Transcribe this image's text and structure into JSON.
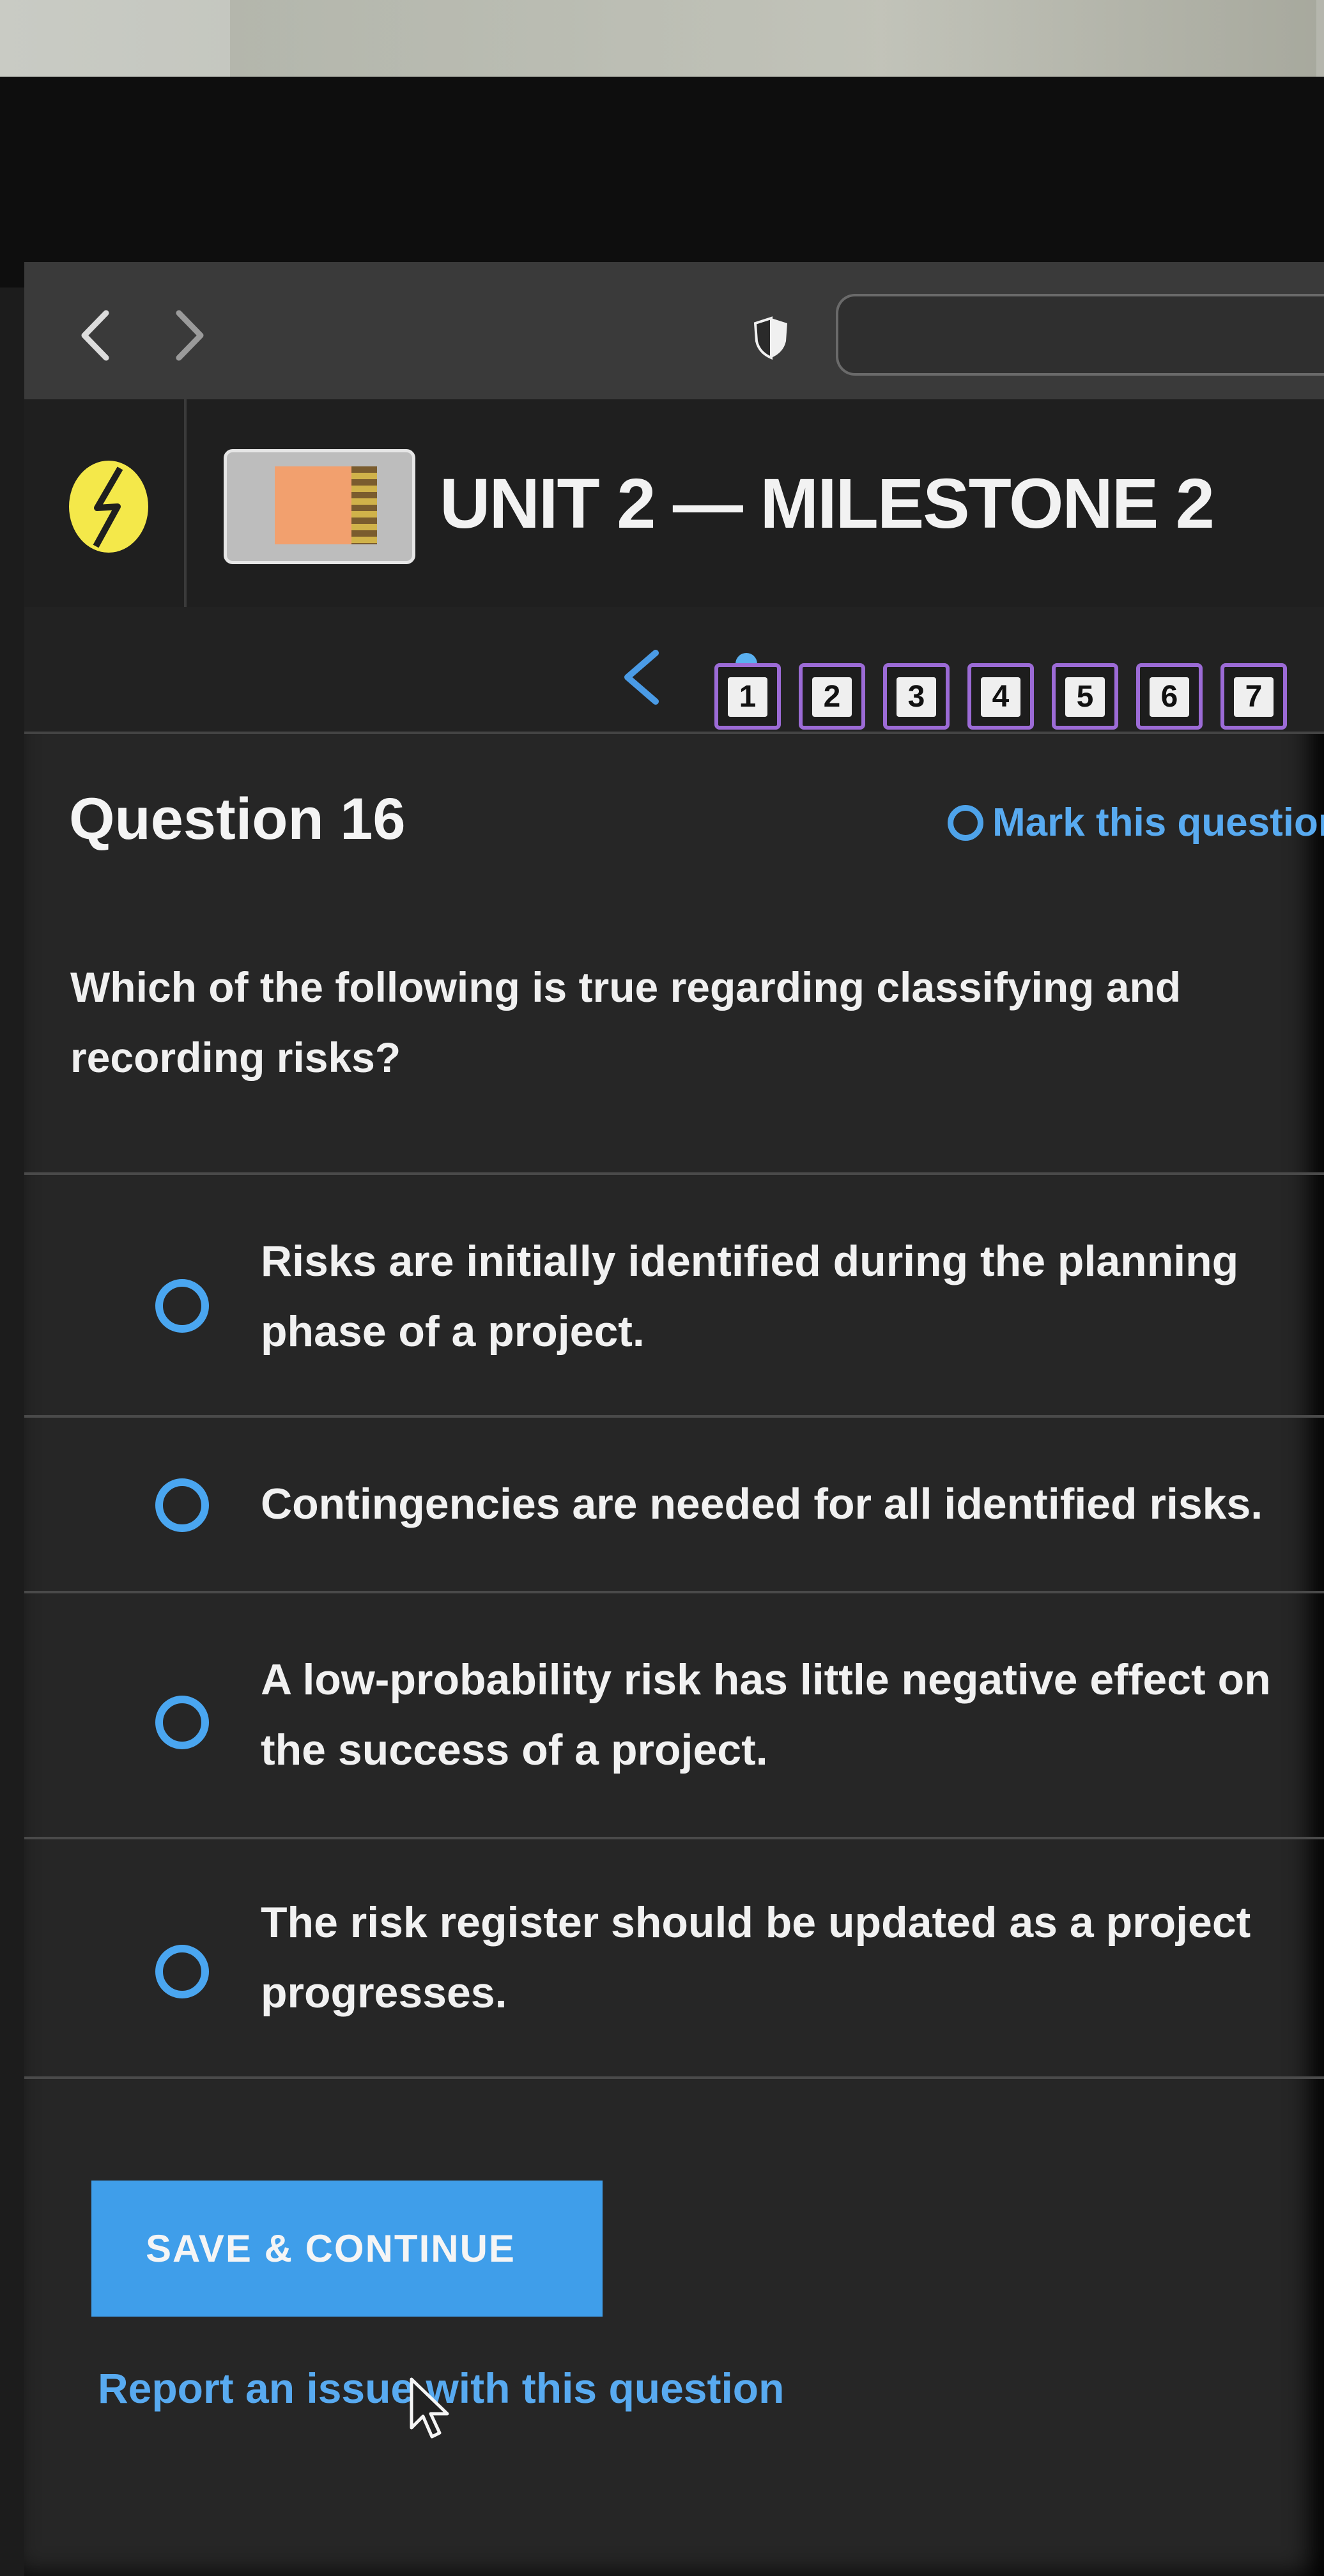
{
  "browser": {
    "back_icon": "chevron-left-icon",
    "forward_icon": "chevron-right-icon",
    "shield_icon": "shield-icon"
  },
  "header": {
    "title": "UNIT 2 — MILESTONE 2"
  },
  "nav": {
    "prev_icon": "chevron-left-icon",
    "numbers": [
      "1",
      "2",
      "3",
      "4",
      "5",
      "6",
      "7"
    ]
  },
  "question": {
    "title": "Question 16",
    "mark_label": "Mark this question",
    "prompt": "Which of the following is true regarding classifying and recording risks?",
    "choices": [
      "Risks are initially identified during the planning phase of a project.",
      "Contingencies are needed for all identified risks.",
      "A low-probability risk has little negative effect on the success of a project.",
      "The risk register should be updated as a project progresses."
    ]
  },
  "actions": {
    "save_label": "SAVE & CONTINUE",
    "report_label": "Report an issue with this question"
  },
  "colors": {
    "accent": "#3f9eea",
    "nav_border": "#9c6bd6",
    "logo": "#f4e84a"
  }
}
